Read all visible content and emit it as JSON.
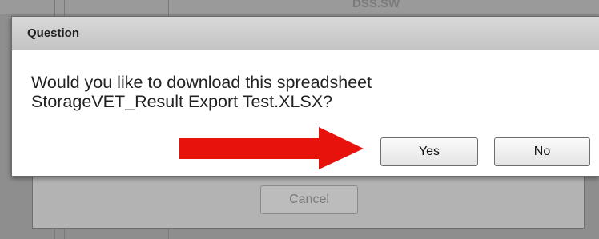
{
  "background": {
    "faint_title": "DSS.SW",
    "cancel_label": "Cancel"
  },
  "dialog": {
    "title": "Question",
    "message_line1": "Would you like to download this spreadsheet",
    "message_line2": "StorageVET_Result Export Test.XLSX?",
    "yes_label": "Yes",
    "no_label": "No"
  },
  "annotation": {
    "arrow_color": "#e8120c"
  }
}
